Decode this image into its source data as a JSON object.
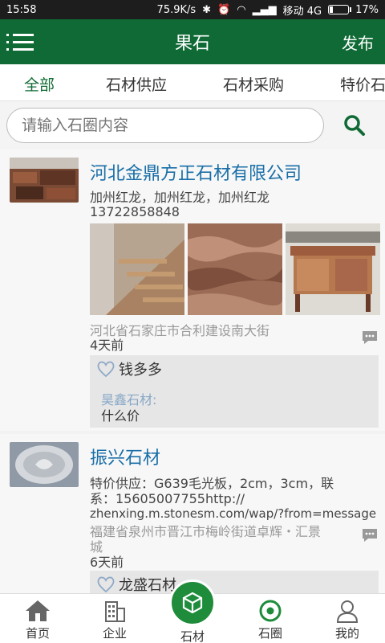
{
  "status_bar": {
    "time": "15:58",
    "net_speed": "75.9K/s",
    "carrier": "移动 4G",
    "battery": "17%",
    "battery_level": 0.17
  },
  "app_bar": {
    "title": "果石",
    "publish_label": "发布"
  },
  "tabs": [
    {
      "label": "全部",
      "active": true
    },
    {
      "label": "石材供应",
      "active": false
    },
    {
      "label": "石材采购",
      "active": false
    },
    {
      "label": "特价石",
      "active": false
    }
  ],
  "search": {
    "placeholder": "请输入石圈内容"
  },
  "posts": [
    {
      "company": "河北金鼎方正石材有限公司",
      "products": "加州红龙，加州红龙，加州红龙",
      "phone": "13722858848",
      "address": "河北省石家庄市合利建设南大街",
      "time_ago": "4天前",
      "like_user": "钱多多",
      "reply_name": "昊鑫石材:",
      "reply_text": "什么价"
    },
    {
      "company": "振兴石材",
      "desc_line1": "特价供应：G639毛光板，2cm，3cm，联",
      "desc_line2": "系：15605007755http://",
      "desc_line3": "zhenxing.m.stonesm.com/wap/?from=message",
      "address_line1": "福建省泉州市晋江市梅岭街道卓辉・汇景",
      "address_line2": "城",
      "time_ago": "6天前",
      "like_user": "龙盛石材"
    }
  ],
  "bottom_nav": [
    {
      "label": "首页",
      "icon": "home-icon"
    },
    {
      "label": "企业",
      "icon": "building-icon"
    },
    {
      "label": "石材",
      "icon": "cube-icon"
    },
    {
      "label": "石圈",
      "icon": "target-icon"
    },
    {
      "label": "我的",
      "icon": "person-icon"
    }
  ],
  "colors": {
    "primary": "#0f6a35",
    "accent": "#1e8c3a",
    "link": "#1a6fa8"
  }
}
